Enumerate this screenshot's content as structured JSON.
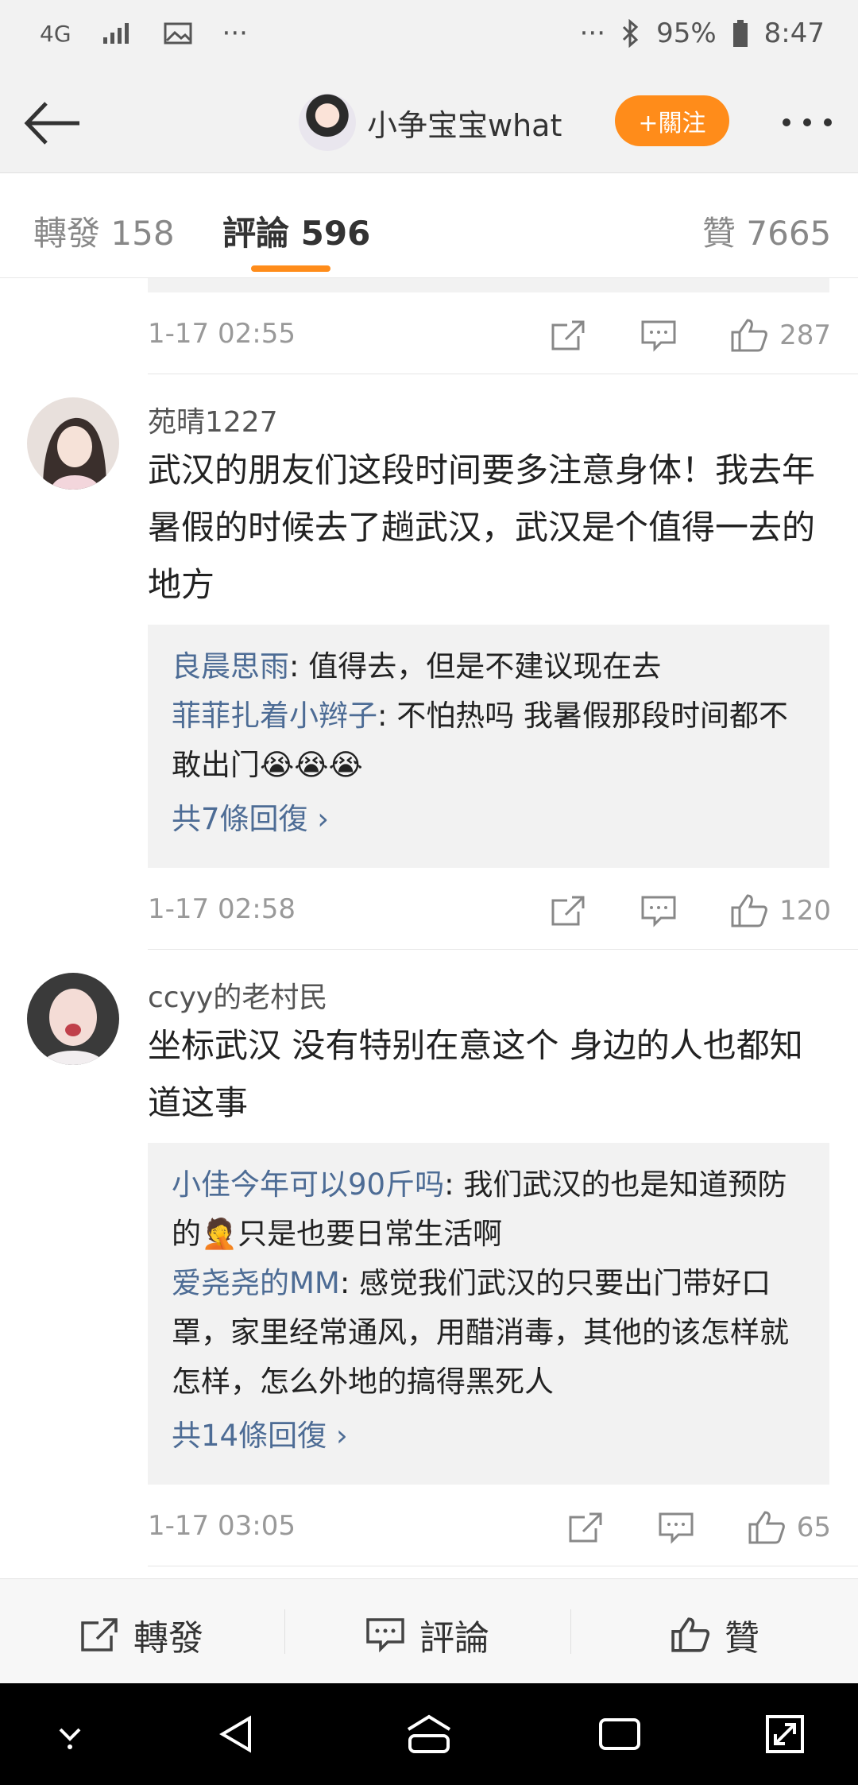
{
  "status_bar": {
    "network": "4G",
    "dots_left": "···",
    "dots_right": "···",
    "battery": "95%",
    "time": "8:47"
  },
  "header": {
    "user_name": "小争宝宝what",
    "follow_label": "+關注"
  },
  "tabs": [
    {
      "label": "轉發",
      "count": "158"
    },
    {
      "label": "評論",
      "count": "596",
      "active": true
    },
    {
      "label": "贊",
      "count": "7665"
    }
  ],
  "comments": [
    {
      "time": "1-17 02:55",
      "likes": "287"
    },
    {
      "user": "苑晴1227",
      "text": "武汉的朋友们这段时间要多注意身体！我去年暑假的时候去了趟武汉，武汉是个值得一去的地方",
      "replies": [
        {
          "name": "良晨思雨",
          "text": ": 值得去，但是不建议现在去"
        },
        {
          "name": "菲菲扎着小辫子",
          "text": ": 不怕热吗 我暑假那段时间都不敢出门😭😭😭"
        }
      ],
      "more_replies": "共7條回復 ›",
      "time": "1-17 02:58",
      "likes": "120"
    },
    {
      "user": "ccyy的老村民",
      "text": "坐标武汉 没有特别在意这个 身边的人也都知道这事",
      "replies": [
        {
          "name": "小佳今年可以90斤吗",
          "text": ": 我们武汉的也是知道预防的🤦只是也要日常生活啊"
        },
        {
          "name": "爱尧尧的MM",
          "text": ": 感觉我们武汉的只要出门带好口罩，家里经常通风，用醋消毒，其他的该怎样就怎样，怎么外地的搞得黑死人"
        }
      ],
      "more_replies": "共14條回復 ›",
      "time": "1-17 03:05",
      "likes": "65"
    }
  ],
  "action_bar": {
    "repost": "轉發",
    "comment": "評論",
    "like": "贊"
  },
  "colors": {
    "accent_orange": "#ff8c1a",
    "link_blue": "#4d6c95",
    "reply_bg": "#f2f2f2"
  }
}
